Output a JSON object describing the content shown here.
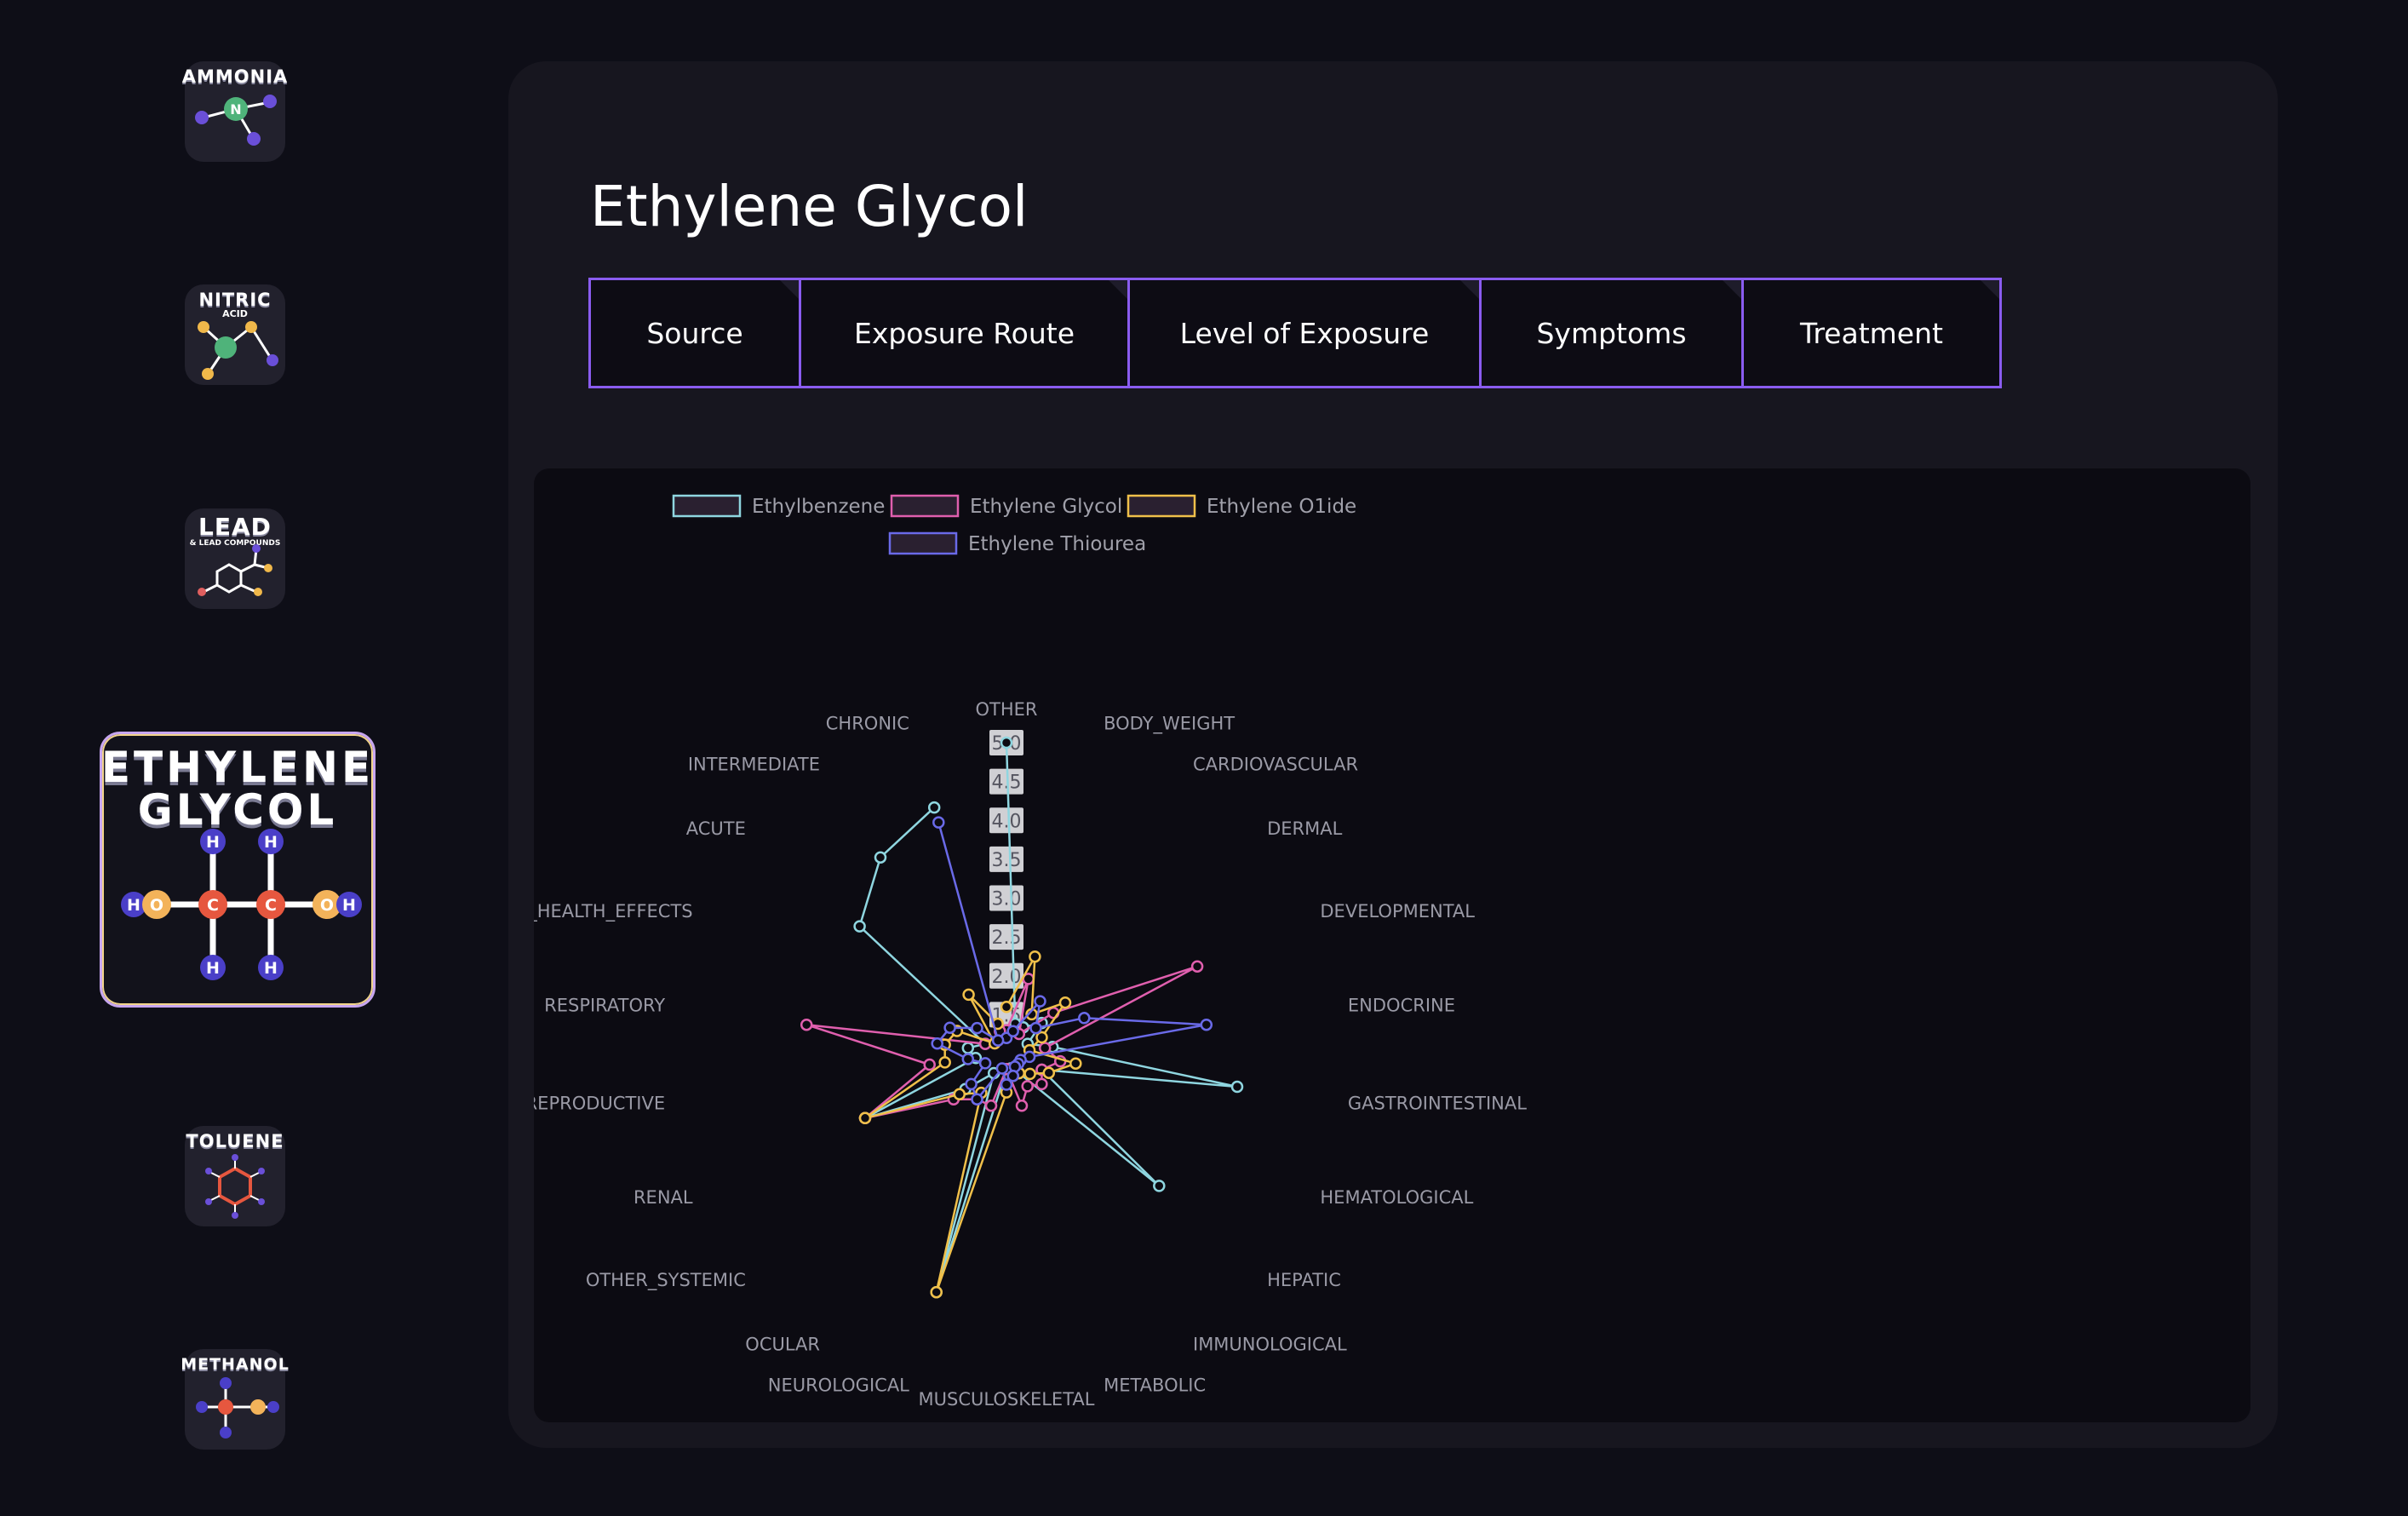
{
  "sidebar": {
    "items": [
      {
        "name": "AMMONIA",
        "sub": "",
        "active": false
      },
      {
        "name": "NITRIC",
        "sub": "ACID",
        "active": false
      },
      {
        "name": "LEAD",
        "sub": "& LEAD COMPOUNDS",
        "active": false
      },
      {
        "name": "ETHYLENE GLYCOL",
        "name_line1": "ETHYLENE",
        "name_line2": "GLYCOL",
        "sub": "",
        "active": true
      },
      {
        "name": "TOLUENE",
        "sub": "",
        "active": false
      },
      {
        "name": "METHANOL",
        "sub": "",
        "active": false
      }
    ],
    "molecule_atom_labels": {
      "hydrogen": "H",
      "carbon": "C",
      "oxygen": "O",
      "nitrogen": "N"
    }
  },
  "main": {
    "title": "Ethylene Glycol",
    "tabs": [
      "Source",
      "Exposure Route",
      "Level of Exposure",
      "Symptoms",
      "Treatment"
    ]
  },
  "colors": {
    "accent": "#8a5cf0",
    "Ethylbenzene": "#8fd6e0",
    "Ethylene Glycol": "#e05fae",
    "Ethylene O1ide": "#f0c04a",
    "Ethylene Thiourea": "#6a6ae8"
  },
  "chart_data": {
    "type": "radar",
    "categories": [
      "OTHER",
      "BODY_WEIGHT",
      "CARDIOVASCULAR",
      "DERMAL",
      "DEVELOPMENTAL",
      "ENDOCRINE",
      "GASTROINTESTINAL",
      "HEMATOLOGICAL",
      "HEPATIC",
      "IMMUNOLOGICAL",
      "METABOLIC",
      "MUSCULOSKELETAL",
      "NEUROLOGICAL",
      "OCULAR",
      "OTHER_SYSTEMIC",
      "RENAL",
      "REPRODUCTIVE",
      "RESPIRATORY",
      "NO_HEALTH_EFFECTS",
      "ACUTE",
      "INTERMEDIATE",
      "CHRONIC"
    ],
    "radial_ticks": [
      "1.5",
      "2.0",
      "2.5",
      "3.0",
      "3.5",
      "4.0",
      "4.5",
      "5.0"
    ],
    "rlim": [
      1,
      5
    ],
    "legend_position": "top-left",
    "series": [
      {
        "name": "Ethylbenzene",
        "values": [
          5.0,
          1.4,
          1.4,
          1.6,
          1.3,
          1.6,
          4.0,
          1.5,
          3.6,
          1.3,
          1.2,
          1.2,
          4.2,
          1.3,
          1.7,
          3.0,
          1.4,
          1.5,
          1.3,
          3.5,
          4.0,
          4.3
        ]
      },
      {
        "name": "Ethylene Glycol",
        "values": [
          1.3,
          2.0,
          1.3,
          1.8,
          3.7,
          1.5,
          1.7,
          1.5,
          1.6,
          1.5,
          1.7,
          1.2,
          1.7,
          1.7,
          1.9,
          3.0,
          2.0,
          3.6,
          1.3,
          1.2,
          1.2,
          1.3
        ]
      },
      {
        "name": "Ethylene O1ide",
        "values": [
          1.6,
          2.3,
          1.6,
          2.0,
          1.5,
          1.3,
          1.9,
          1.6,
          1.4,
          1.3,
          1.3,
          1.5,
          4.2,
          1.6,
          1.8,
          3.0,
          1.8,
          1.8,
          1.7,
          1.2,
          1.9,
          1.4
        ]
      },
      {
        "name": "Ethylene Thiourea",
        "values": [
          1.2,
          1.3,
          1.8,
          1.5,
          2.1,
          3.6,
          1.3,
          1.2,
          1.2,
          1.2,
          1.3,
          1.4,
          1.2,
          1.7,
          1.6,
          1.3,
          1.5,
          1.9,
          1.8,
          1.5,
          1.2,
          4.1
        ]
      }
    ]
  }
}
